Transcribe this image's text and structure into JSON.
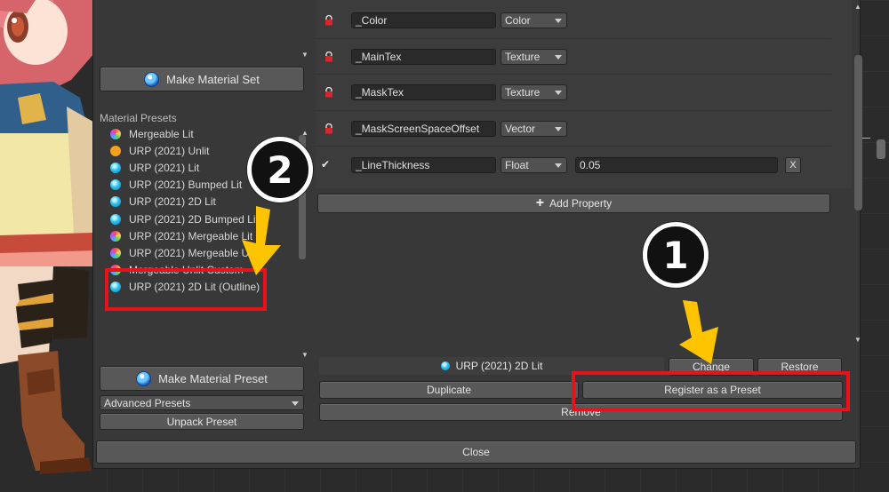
{
  "left_panel": {
    "make_material_set_label": "Make Material Set",
    "section_title": "Material Presets",
    "presets": [
      {
        "label": "Mergeable Lit",
        "icon": "rainbow"
      },
      {
        "label": "URP (2021) Unlit",
        "icon": "orange"
      },
      {
        "label": "URP (2021) Lit",
        "icon": "cyan"
      },
      {
        "label": "URP (2021) Bumped Lit",
        "icon": "cyan"
      },
      {
        "label": "URP (2021) 2D Lit",
        "icon": "cyan"
      },
      {
        "label": "URP (2021) 2D Bumped Lit",
        "icon": "cyan"
      },
      {
        "label": "URP (2021) Mergeable Lit",
        "icon": "rainbow"
      },
      {
        "label": "URP (2021) Mergeable Unlit",
        "icon": "rainbow"
      },
      {
        "label": "Mergeable Unlit Custom",
        "icon": "rainbow"
      },
      {
        "label": "URP (2021) 2D Lit (Outline)",
        "icon": "cyan"
      }
    ],
    "make_material_preset_label": "Make Material Preset",
    "advanced_presets_label": "Advanced Presets",
    "unpack_preset_label": "Unpack Preset"
  },
  "properties": [
    {
      "name": "_Color",
      "type": "Color",
      "locked": true
    },
    {
      "name": "_MainTex",
      "type": "Texture",
      "locked": true
    },
    {
      "name": "_MaskTex",
      "type": "Texture",
      "locked": true
    },
    {
      "name": "_MaskScreenSpaceOffset",
      "type": "Vector",
      "locked": true
    },
    {
      "name": "_LineThickness",
      "type": "Float",
      "locked": false,
      "value": "0.05",
      "remove_label": "X"
    }
  ],
  "add_property_label": "Add Property",
  "selected_preset": {
    "label": "URP (2021) 2D Lit",
    "icon": "cyan"
  },
  "buttons": {
    "change": "Change",
    "restore": "Restore",
    "duplicate": "Duplicate",
    "register": "Register as a Preset",
    "remove": "Remove",
    "close": "Close"
  },
  "annotations": {
    "step1": "1",
    "step2": "2"
  },
  "colors": {
    "highlight_red": "#e8121d",
    "arrow_yellow": "#ffc400"
  }
}
